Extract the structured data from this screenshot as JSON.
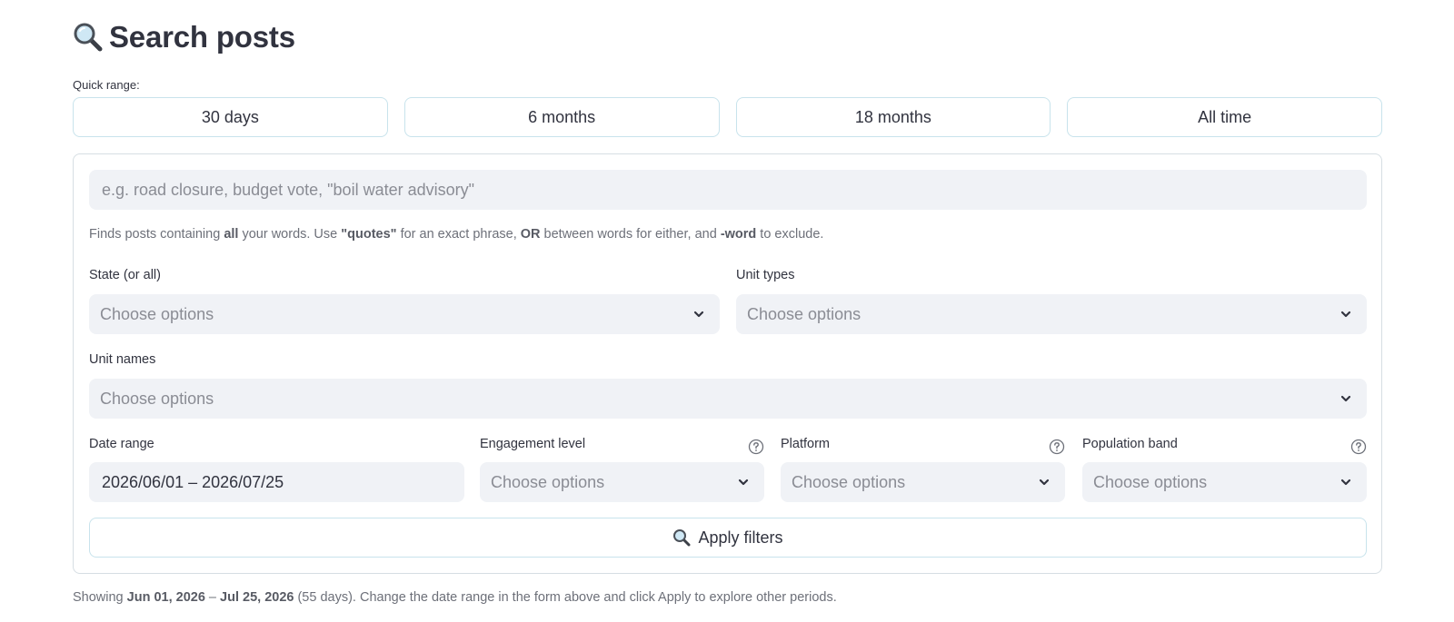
{
  "header": {
    "icon": "magnifier-icon",
    "title": "Search posts"
  },
  "quick_range": {
    "label": "Quick range:",
    "options": [
      "30 days",
      "6 months",
      "18 months",
      "All time"
    ]
  },
  "search": {
    "placeholder": "e.g. road closure, budget vote, \"boil water advisory\"",
    "value": ""
  },
  "help": {
    "p1": "Finds posts containing ",
    "b1": "all",
    "p2": " your words. Use ",
    "b2": "\"quotes\"",
    "p3": " for an exact phrase, ",
    "b3": "OR",
    "p4": " between words for either, and ",
    "b4": "-word",
    "p5": " to exclude."
  },
  "fields": {
    "state": {
      "label": "State (or all)",
      "placeholder": "Choose options"
    },
    "unit_types": {
      "label": "Unit types",
      "placeholder": "Choose options"
    },
    "unit_names": {
      "label": "Unit names",
      "placeholder": "Choose options"
    },
    "date_range": {
      "label": "Date range",
      "value": "2026/06/01 – 2026/07/25"
    },
    "engagement": {
      "label": "Engagement level",
      "placeholder": "Choose options"
    },
    "platform": {
      "label": "Platform",
      "placeholder": "Choose options"
    },
    "population": {
      "label": "Population band",
      "placeholder": "Choose options"
    }
  },
  "apply": {
    "label": "Apply filters",
    "icon": "magnifier-icon"
  },
  "footer": {
    "p1": "Showing ",
    "b1": "Jun 01, 2026",
    "p2": " – ",
    "b2": "Jul 25, 2026",
    "p3": " (55 days). Change the date range in the form above and click Apply to explore other periods."
  },
  "colors": {
    "accent_border": "#c8e3ec",
    "input_bg": "#f0f2f6",
    "text": "#31333f",
    "muted": "#6d7079"
  }
}
